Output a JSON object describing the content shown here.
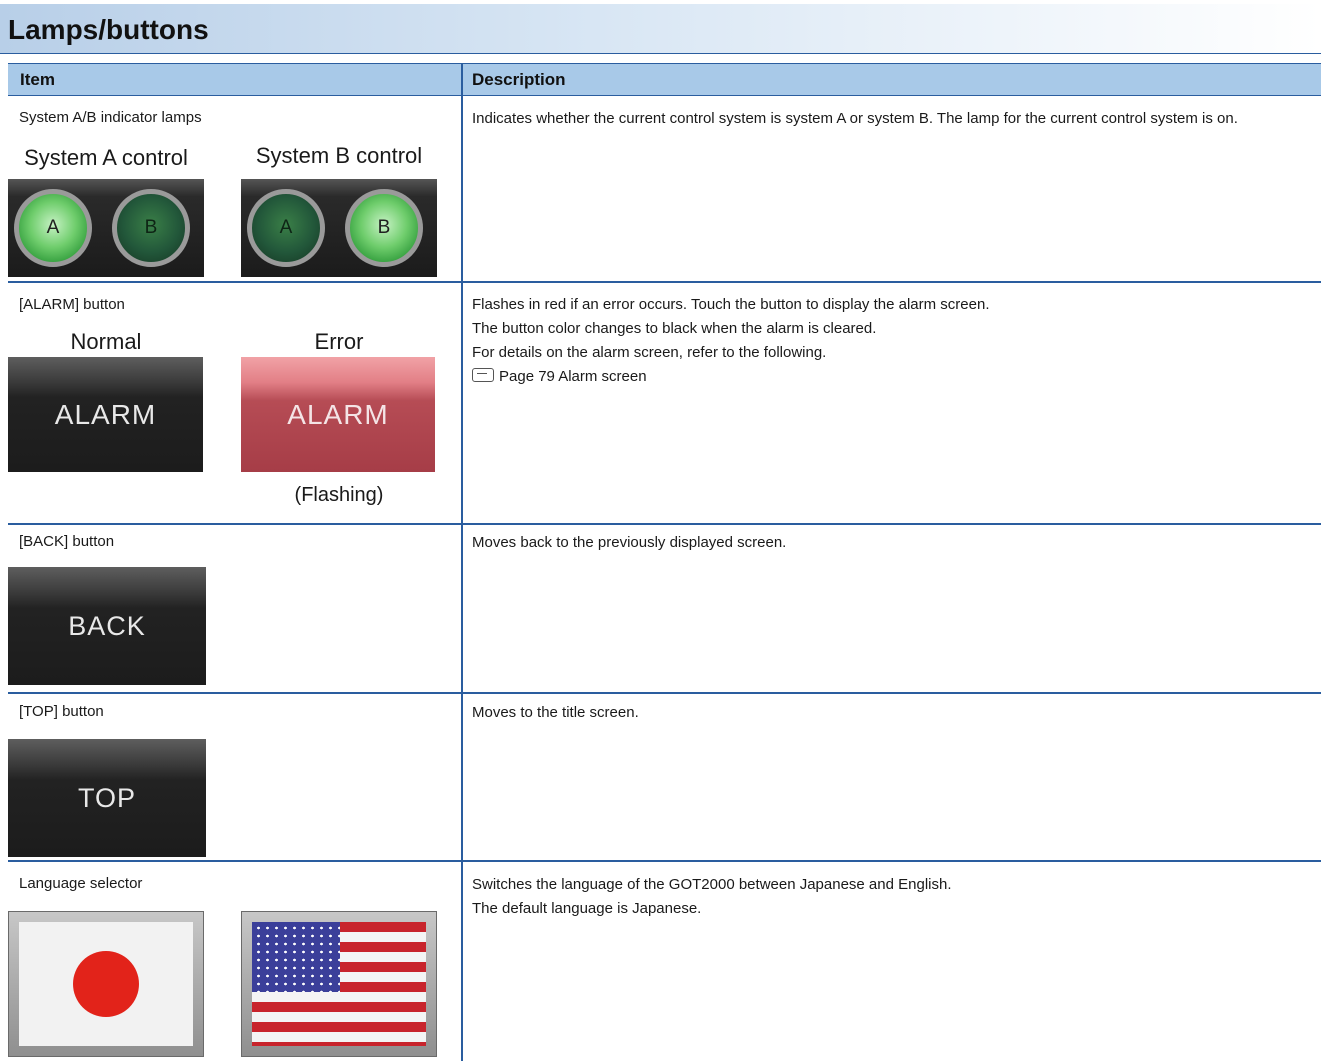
{
  "section": {
    "title": "Lamps/buttons"
  },
  "table": {
    "headers": {
      "item": "Item",
      "description": "Description"
    },
    "rows": [
      {
        "item": "System A/B indicator lamps",
        "captions": [
          "System A control",
          "System B control"
        ],
        "lamp_letters": [
          "A",
          "B"
        ],
        "description": [
          "Indicates whether the current control system is system A or system B. The lamp for the current control system is on."
        ]
      },
      {
        "item": "[ALARM] button",
        "captions": [
          "Normal",
          "Error"
        ],
        "button_label": "ALARM",
        "note": "(Flashing)",
        "description": [
          "Flashes in red if an error occurs. Touch the button to display the alarm screen.",
          "The button color changes to black when the alarm is cleared.",
          "For details on the alarm screen, refer to the following."
        ],
        "reference": "Page 79 Alarm screen"
      },
      {
        "item": "[BACK] button",
        "button_label": "BACK",
        "description": [
          "Moves back to the previously displayed screen."
        ]
      },
      {
        "item": "[TOP] button",
        "button_label": "TOP",
        "description": [
          "Moves to the title screen."
        ]
      },
      {
        "item": "Language selector",
        "flags": [
          "japan-flag-icon",
          "us-flag-icon"
        ],
        "description": [
          "Switches the language of the GOT2000 between Japanese and English.",
          "The default language is Japanese."
        ]
      }
    ]
  },
  "colors": {
    "rule": "#2a5d9f",
    "header_bg": "#a8c9e8",
    "lamp_on": "#6fcd6c",
    "alarm_error": "#b64c55"
  }
}
